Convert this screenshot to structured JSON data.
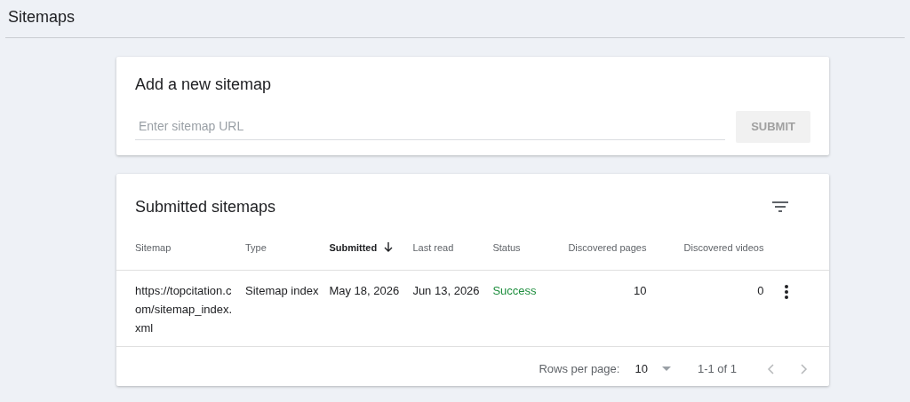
{
  "page": {
    "title": "Sitemaps"
  },
  "add_card": {
    "title": "Add a new sitemap",
    "url_field": {
      "placeholder": "Enter sitemap URL"
    },
    "submit": {
      "label": "SUBMIT",
      "disabled": true
    }
  },
  "table_card": {
    "title": "Submitted sitemaps",
    "columns": [
      {
        "label": "Sitemap",
        "sorted": false
      },
      {
        "label": "Type",
        "sorted": false
      },
      {
        "label": "Submitted",
        "sorted": true
      },
      {
        "label": "Last read",
        "sorted": false
      },
      {
        "label": "Status",
        "sorted": false
      },
      {
        "label": "Discovered pages",
        "sorted": false
      },
      {
        "label": "Discovered videos",
        "sorted": false
      }
    ],
    "rows": [
      {
        "cells": [
          "https://topcitation.com/sitemap_index.xml",
          "Sitemap index",
          "May 18, 2026",
          "Jun 13, 2026",
          "Success",
          "10",
          "0"
        ],
        "color": "#1e8e3e"
      }
    ],
    "pagination": {
      "rows_per_page_label": "Rows per page:",
      "rows_per_page": "10",
      "range": "1-1 of 1",
      "prev_disabled": true,
      "next_disabled": true
    }
  }
}
